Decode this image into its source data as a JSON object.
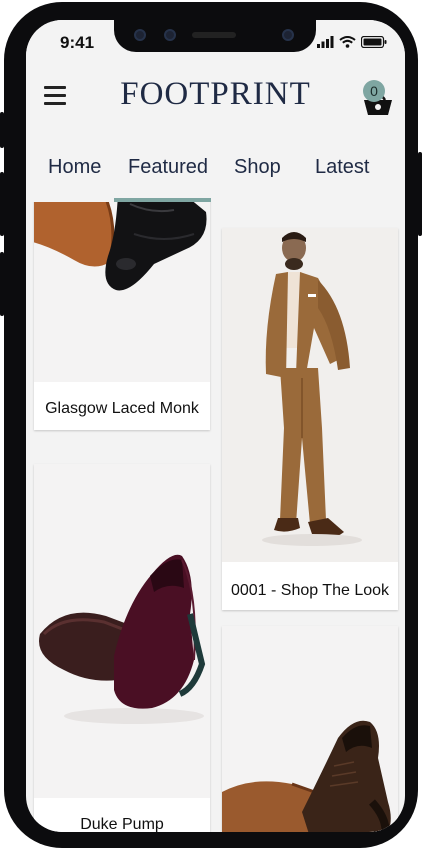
{
  "status": {
    "time": "9:41"
  },
  "header": {
    "brand": "FOOTPRINT",
    "cart_count": "0"
  },
  "tabs": [
    {
      "label": "Home"
    },
    {
      "label": "Featured"
    },
    {
      "label": "Shop"
    },
    {
      "label": "Latest"
    }
  ],
  "active_tab": "Featured",
  "products": [
    {
      "title": "Glasgow Laced Monk"
    },
    {
      "title": "0001 - Shop The Look"
    },
    {
      "title": "Duke Pump"
    },
    {
      "title": ""
    }
  ],
  "colors": {
    "accent": "#7fa6a2",
    "brand_text": "#1f2a44",
    "background": "#f3f3f3"
  }
}
